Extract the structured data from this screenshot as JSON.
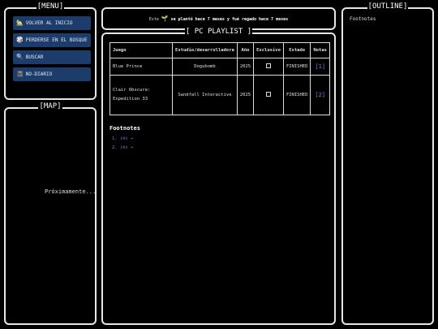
{
  "menu": {
    "title": "[MENU]",
    "items": [
      {
        "icon": "🏡",
        "label": "VOLVER AL INICIO"
      },
      {
        "icon": "🎲",
        "label": "PERDERSE EN EL BOSQUE"
      },
      {
        "icon": "🔍",
        "label": "BUSCAR"
      },
      {
        "icon": "📓",
        "label": "NO-DIARIO"
      }
    ]
  },
  "map": {
    "title": "[MAP]",
    "placeholder": "Próximamente..."
  },
  "notice": {
    "prefix": "Este",
    "icon": "🌱",
    "text": "se plantó hace 7 meses y fué regado hace 7 meses"
  },
  "page": {
    "title": "[ PC PLAYLIST ]"
  },
  "table": {
    "headers": [
      "Juego",
      "Estudio/desarrolladora",
      "Año",
      "Exclusivo",
      "Estado",
      "Notas"
    ],
    "rows": [
      {
        "game": "Blue Prince",
        "studio": "Dogubomb",
        "year": "2025",
        "status": "FINISHED",
        "note": "[1]"
      },
      {
        "game": "Clair Obscure: Expedition 33",
        "studio": "Sandfall Interactive",
        "year": "2025",
        "status": "FINISHED",
        "note": "[2]"
      }
    ]
  },
  "footnotes": {
    "title": "Footnotes",
    "items": [
      "1. (®) ↩",
      "2. (®) ↩"
    ]
  },
  "outline": {
    "title": "[OUTLINE]",
    "items": [
      "Footnotes"
    ]
  }
}
